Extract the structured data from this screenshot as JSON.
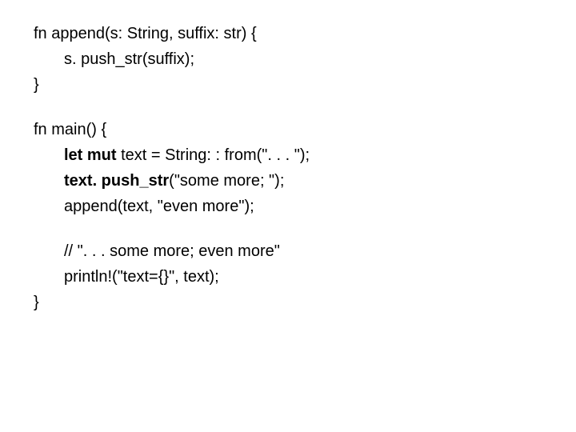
{
  "code": {
    "l1": "fn append(s: String, suffix: str) {",
    "l2": "s. push_str(suffix);",
    "l3": "}",
    "l4": "fn main() {",
    "l5_a": "let mut ",
    "l5_b": "text = String: : from(\". . . \");",
    "l6_a": "text. push_str",
    "l6_b": "(\"some more; \");",
    "l7": "append(text, \"even more\");",
    "l8": "// \". . . some more; even more\"",
    "l9": "println!(\"text={}\", text);",
    "l10": "}"
  }
}
